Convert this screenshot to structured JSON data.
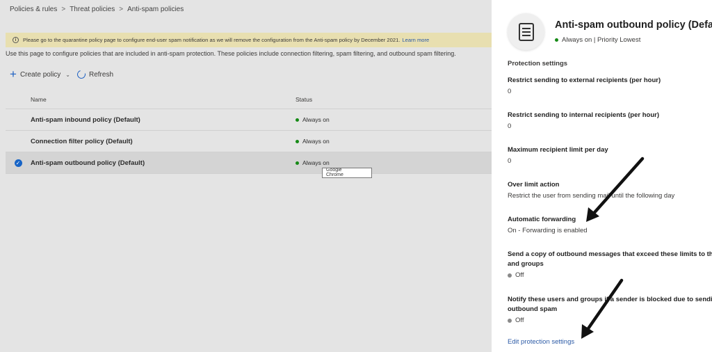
{
  "breadcrumb": [
    "Policies & rules",
    "Threat policies",
    "Anti-spam policies"
  ],
  "banner": {
    "text": "Please go to the quarantine policy page to configure end-user spam notification as we will remove the configuration from the Anti-spam policy by December 2021.",
    "link": "Learn more"
  },
  "description": "Use this page to configure policies that are included in anti-spam protection. These policies include connection filtering, spam filtering, and outbound spam filtering.",
  "toolbar": {
    "create_label": "Create policy",
    "refresh_label": "Refresh"
  },
  "table": {
    "headers": {
      "name": "Name",
      "status": "Status"
    },
    "rows": [
      {
        "name": "Anti-spam inbound policy (Default)",
        "status": "Always on"
      },
      {
        "name": "Connection filter policy (Default)",
        "status": "Always on"
      },
      {
        "name": "Anti-spam outbound policy (Default)",
        "status": "Always on"
      }
    ]
  },
  "tooltip": {
    "line1": "Google",
    "line2": "Chrome"
  },
  "panel": {
    "title": "Anti-spam outbound policy (Default)",
    "subtitle": "Always on | Priority Lowest",
    "section": "Protection settings",
    "fields": [
      {
        "label": "Restrict sending to external recipients (per hour)",
        "value": "0"
      },
      {
        "label": "Restrict sending to internal recipients (per hour)",
        "value": "0"
      },
      {
        "label": "Maximum recipient limit per day",
        "value": "0"
      },
      {
        "label": "Over limit action",
        "value": "Restrict the user from sending mail until the following day"
      },
      {
        "label": "Automatic forwarding",
        "value": "On - Forwarding is enabled"
      },
      {
        "label": "Send a copy of outbound messages that exceed these limits to these users",
        "label2": "and groups",
        "value": "Off"
      },
      {
        "label": "Notify these users and groups if a sender is blocked due to sending",
        "label2": "outbound spam",
        "value": "Off"
      }
    ],
    "edit_link": "Edit protection settings"
  },
  "colors": {
    "accent": "#1b5fc2",
    "link": "#2b5aa6",
    "status_on": "#168a16",
    "banner": "#e8dfb0"
  }
}
